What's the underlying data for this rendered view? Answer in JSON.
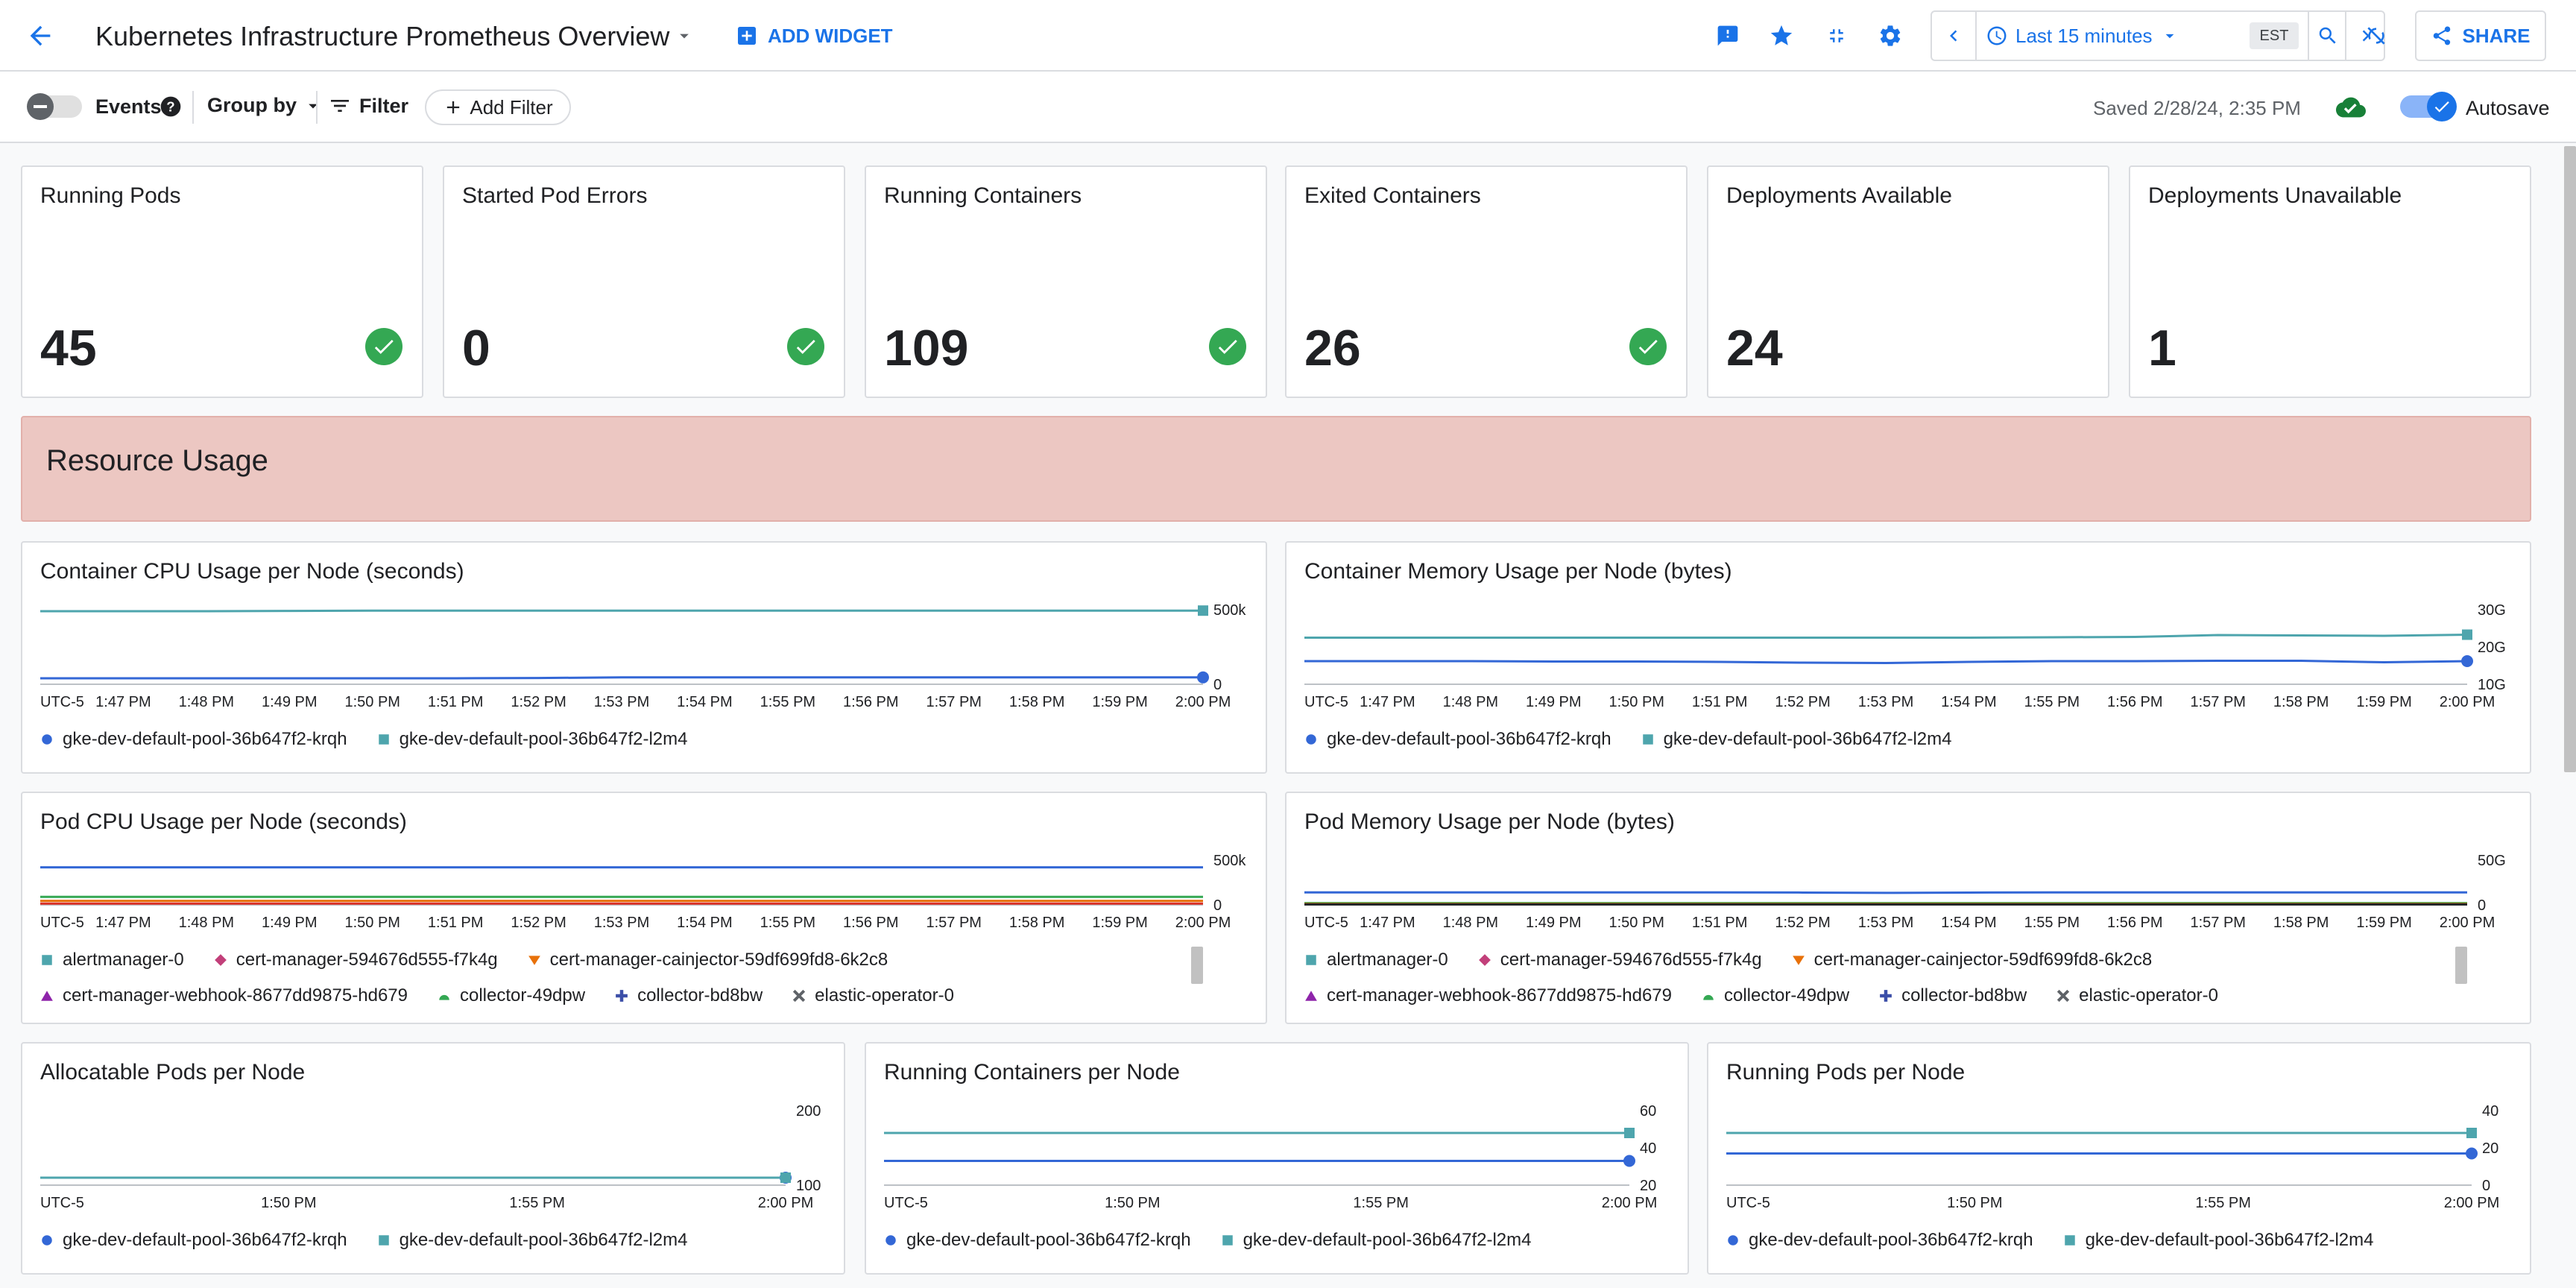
{
  "header": {
    "title": "Kubernetes Infrastructure Prometheus Overview",
    "add_widget": "ADD WIDGET",
    "time_range": "Last 15 minutes",
    "timezone": "EST",
    "share": "SHARE"
  },
  "toolbar": {
    "events": "Events",
    "group_by": "Group by",
    "filter": "Filter",
    "add_filter": "Add Filter",
    "saved": "Saved 2/28/24, 2:35 PM",
    "autosave": "Autosave"
  },
  "scorecards": [
    {
      "title": "Running Pods",
      "value": "45",
      "status": "ok"
    },
    {
      "title": "Started Pod Errors",
      "value": "0",
      "status": "ok"
    },
    {
      "title": "Running Containers",
      "value": "109",
      "status": "ok"
    },
    {
      "title": "Exited Containers",
      "value": "26",
      "status": "ok"
    },
    {
      "title": "Deployments Available",
      "value": "24",
      "status": "none"
    },
    {
      "title": "Deployments Unavailable",
      "value": "1",
      "status": "none"
    }
  ],
  "section": {
    "title": "Resource Usage"
  },
  "colors": {
    "blue": "#3367d6",
    "teal": "#4ea5ad",
    "accent": "#1a73e8",
    "ok": "#34a853",
    "section_bg": "#ecc7c2"
  },
  "legends": {
    "nodes": [
      {
        "label": "gke-dev-default-pool-36b647f2-krqh",
        "marker": "circle",
        "color": "#3367d6"
      },
      {
        "label": "gke-dev-default-pool-36b647f2-l2m4",
        "marker": "square",
        "color": "#4ea5ad"
      }
    ],
    "pods": [
      {
        "label": "alertmanager-0",
        "marker": "square",
        "color": "#4ea5ad"
      },
      {
        "label": "cert-manager-594676d555-f7k4g",
        "marker": "diamond",
        "color": "#c2407a"
      },
      {
        "label": "cert-manager-cainjector-59df699fd8-6k2c8",
        "marker": "triangle-down",
        "color": "#e8710a"
      },
      {
        "label": "cert-manager-webhook-8677dd9875-hd679",
        "marker": "triangle-up",
        "color": "#8e24aa"
      },
      {
        "label": "collector-49dpw",
        "marker": "semicircle",
        "color": "#34a853"
      },
      {
        "label": "collector-bd8bw",
        "marker": "plus",
        "color": "#3c4fa8"
      },
      {
        "label": "elastic-operator-0",
        "marker": "x",
        "color": "#5f6368"
      }
    ]
  },
  "chart_data": [
    {
      "type": "line",
      "title": "Container CPU Usage per Node (seconds)",
      "x": [
        "UTC-5",
        "1:47 PM",
        "1:48 PM",
        "1:49 PM",
        "1:50 PM",
        "1:51 PM",
        "1:52 PM",
        "1:53 PM",
        "1:54 PM",
        "1:55 PM",
        "1:56 PM",
        "1:57 PM",
        "1:58 PM",
        "1:59 PM",
        "2:00 PM"
      ],
      "y_ticks": [
        "0",
        "500k"
      ],
      "ylim": [
        0,
        500000
      ],
      "series": [
        {
          "name": "gke-dev-default-pool-36b647f2-l2m4",
          "color": "#4ea5ad",
          "values": [
            490000,
            490000,
            490000,
            492000,
            494000,
            494000,
            494000,
            494000,
            494000,
            494000,
            494000,
            494000,
            494000,
            494000,
            494000
          ]
        },
        {
          "name": "gke-dev-default-pool-36b647f2-krqh",
          "color": "#3367d6",
          "values": [
            40000,
            40000,
            40000,
            40000,
            40000,
            40000,
            42000,
            46000,
            46000,
            46000,
            46000,
            46000,
            46000,
            46000,
            46000
          ]
        }
      ]
    },
    {
      "type": "line",
      "title": "Container Memory Usage per Node (bytes)",
      "x": [
        "UTC-5",
        "1:47 PM",
        "1:48 PM",
        "1:49 PM",
        "1:50 PM",
        "1:51 PM",
        "1:52 PM",
        "1:53 PM",
        "1:54 PM",
        "1:55 PM",
        "1:56 PM",
        "1:57 PM",
        "1:58 PM",
        "1:59 PM",
        "2:00 PM"
      ],
      "y_ticks": [
        "10G",
        "20G",
        "30G"
      ],
      "ylim": [
        10,
        30
      ],
      "series": [
        {
          "name": "gke-dev-default-pool-36b647f2-l2m4",
          "color": "#4ea5ad",
          "values": [
            22.5,
            22.5,
            22.5,
            22.5,
            22.5,
            22.5,
            22.5,
            22.5,
            22.5,
            22.6,
            22.7,
            23.2,
            23.1,
            23.0,
            23.3
          ]
        },
        {
          "name": "gke-dev-default-pool-36b647f2-krqh",
          "color": "#3367d6",
          "values": [
            16.2,
            16.2,
            16.2,
            16.1,
            16.1,
            16.0,
            15.8,
            15.7,
            16.0,
            16.2,
            16.2,
            16.3,
            16.3,
            15.9,
            16.2
          ]
        }
      ]
    },
    {
      "type": "line",
      "title": "Pod CPU Usage per Node (seconds)",
      "x": [
        "UTC-5",
        "1:47 PM",
        "1:48 PM",
        "1:49 PM",
        "1:50 PM",
        "1:51 PM",
        "1:52 PM",
        "1:53 PM",
        "1:54 PM",
        "1:55 PM",
        "1:56 PM",
        "1:57 PM",
        "1:58 PM",
        "1:59 PM",
        "2:00 PM"
      ],
      "y_ticks": [
        "0",
        "500k"
      ],
      "ylim": [
        0,
        500000
      ],
      "series": [
        {
          "name": "",
          "color": "#3367d6",
          "values": [
            420000,
            420000,
            420000,
            420000,
            420000,
            420000,
            420000,
            420000,
            420000,
            420000,
            420000,
            420000,
            420000,
            420000,
            420000
          ]
        },
        {
          "name": "",
          "color": "#34a853",
          "values": [
            90000,
            90000,
            90000,
            90000,
            90000,
            90000,
            90000,
            90000,
            90000,
            90000,
            90000,
            90000,
            90000,
            90000,
            90000
          ]
        },
        {
          "name": "",
          "color": "#e8710a",
          "values": [
            45000,
            45000,
            45000,
            45000,
            45000,
            45000,
            45000,
            45000,
            45000,
            45000,
            45000,
            45000,
            45000,
            45000,
            45000
          ]
        },
        {
          "name": "",
          "color": "#d93025",
          "values": [
            15000,
            15000,
            15000,
            15000,
            15000,
            15000,
            15000,
            15000,
            15000,
            15000,
            15000,
            15000,
            15000,
            15000,
            15000
          ]
        }
      ]
    },
    {
      "type": "line",
      "title": "Pod Memory Usage per Node (bytes)",
      "x": [
        "UTC-5",
        "1:47 PM",
        "1:48 PM",
        "1:49 PM",
        "1:50 PM",
        "1:51 PM",
        "1:52 PM",
        "1:53 PM",
        "1:54 PM",
        "1:55 PM",
        "1:56 PM",
        "1:57 PM",
        "1:58 PM",
        "1:59 PM",
        "2:00 PM"
      ],
      "y_ticks": [
        "0",
        "50G"
      ],
      "ylim": [
        0,
        50
      ],
      "series": [
        {
          "name": "",
          "color": "#3367d6",
          "values": [
            14,
            14,
            14,
            14,
            14,
            14,
            13.8,
            13.4,
            13.8,
            14,
            14,
            14,
            14,
            14,
            14
          ]
        },
        {
          "name": "",
          "color": "#34a853",
          "values": [
            2,
            2,
            2,
            2,
            2,
            2,
            2,
            2,
            2,
            2,
            2,
            2,
            2,
            2,
            2
          ]
        },
        {
          "name": "",
          "color": "#e8710a",
          "values": [
            1,
            1,
            1,
            1,
            1,
            1,
            1,
            1,
            1,
            1,
            1,
            1,
            1,
            1,
            1
          ]
        },
        {
          "name": "",
          "color": "#202124",
          "values": [
            0.5,
            0.5,
            0.5,
            0.5,
            0.5,
            0.5,
            0.5,
            0.5,
            0.5,
            0.5,
            0.5,
            0.5,
            0.5,
            0.5,
            0.5
          ]
        }
      ]
    },
    {
      "type": "line",
      "title": "Allocatable Pods per Node",
      "x": [
        "UTC-5",
        "1:50 PM",
        "1:55 PM",
        "2:00 PM"
      ],
      "y_ticks": [
        "100",
        "200"
      ],
      "ylim": [
        100,
        200
      ],
      "series": [
        {
          "name": "gke-dev-default-pool-36b647f2-krqh",
          "color": "#3367d6",
          "values": [
            110,
            110,
            110,
            110
          ]
        },
        {
          "name": "gke-dev-default-pool-36b647f2-l2m4",
          "color": "#4ea5ad",
          "values": [
            110,
            110,
            110,
            110
          ]
        }
      ]
    },
    {
      "type": "line",
      "title": "Running Containers per Node",
      "x": [
        "UTC-5",
        "1:50 PM",
        "1:55 PM",
        "2:00 PM"
      ],
      "y_ticks": [
        "20",
        "40",
        "60"
      ],
      "ylim": [
        20,
        60
      ],
      "series": [
        {
          "name": "gke-dev-default-pool-36b647f2-l2m4",
          "color": "#4ea5ad",
          "values": [
            48,
            48,
            48,
            48
          ]
        },
        {
          "name": "gke-dev-default-pool-36b647f2-krqh",
          "color": "#3367d6",
          "values": [
            33,
            33,
            33,
            33
          ]
        }
      ]
    },
    {
      "type": "line",
      "title": "Running Pods per Node",
      "x": [
        "UTC-5",
        "1:50 PM",
        "1:55 PM",
        "2:00 PM"
      ],
      "y_ticks": [
        "0",
        "20",
        "40"
      ],
      "ylim": [
        0,
        40
      ],
      "series": [
        {
          "name": "gke-dev-default-pool-36b647f2-l2m4",
          "color": "#4ea5ad",
          "values": [
            28,
            28,
            28,
            28
          ]
        },
        {
          "name": "gke-dev-default-pool-36b647f2-krqh",
          "color": "#3367d6",
          "values": [
            17,
            17,
            17,
            17
          ]
        }
      ]
    }
  ]
}
